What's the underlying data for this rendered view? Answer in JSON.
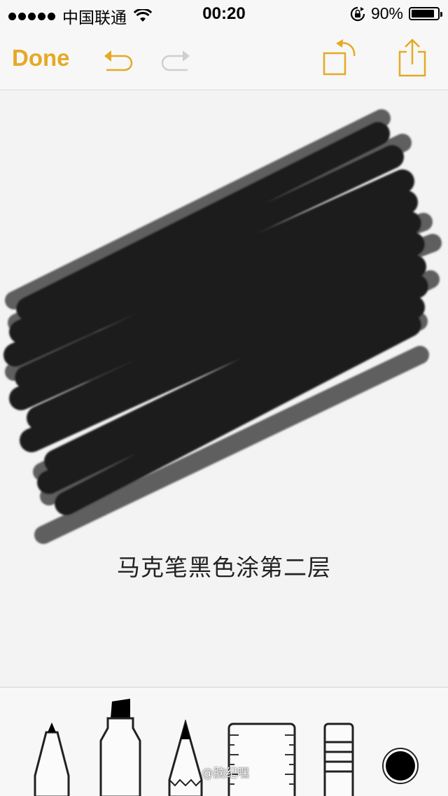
{
  "status_bar": {
    "carrier": "中国联通",
    "time": "00:20",
    "battery_percent": "90%",
    "battery_level": 0.9,
    "signal_bars": 5
  },
  "toolbar": {
    "done_label": "Done",
    "accent_color": "#e6a923",
    "icons": [
      "undo-icon",
      "redo-icon",
      "rotate-canvas-icon",
      "share-icon"
    ]
  },
  "canvas": {
    "caption": "马克笔黑色涂第二层",
    "scribble_color": "#1c1c1c"
  },
  "tools": {
    "items": [
      "pen",
      "marker",
      "pencil",
      "ruler",
      "eraser",
      "color-picker"
    ],
    "selected_color": "#000000",
    "watermark": "@脑纪嘿"
  }
}
